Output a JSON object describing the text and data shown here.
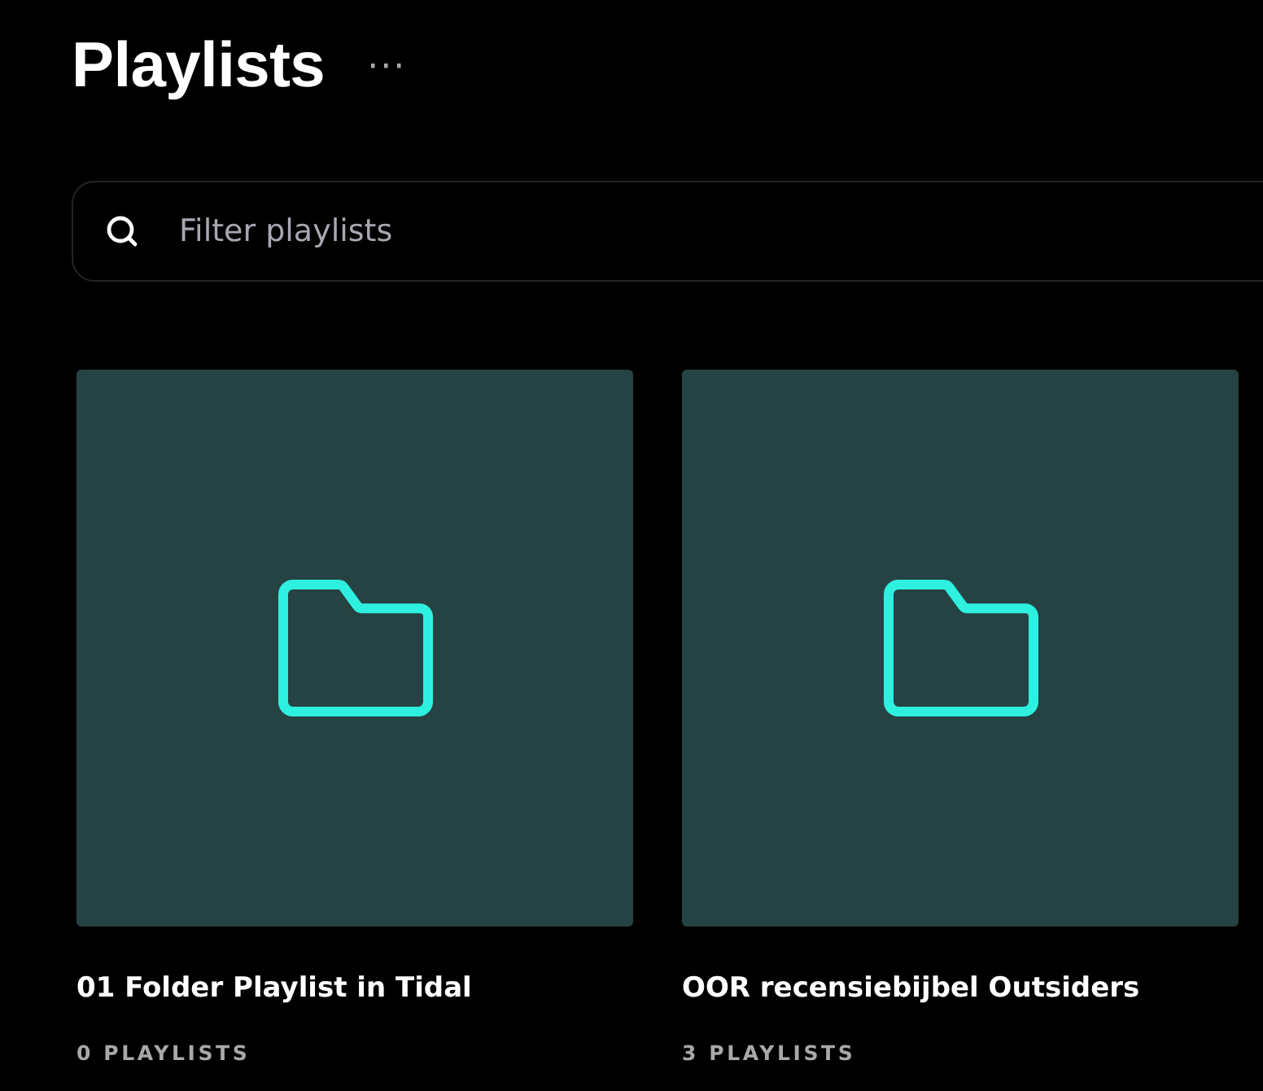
{
  "header": {
    "title": "Playlists",
    "more_button": "···"
  },
  "search": {
    "placeholder": "Filter playlists"
  },
  "folders": [
    {
      "name": "01 Folder Playlist in Tidal",
      "count": "0 PLAYLISTS"
    },
    {
      "name": "OOR recensiebijbel Outsiders",
      "count": "3 PLAYLISTS"
    }
  ]
}
